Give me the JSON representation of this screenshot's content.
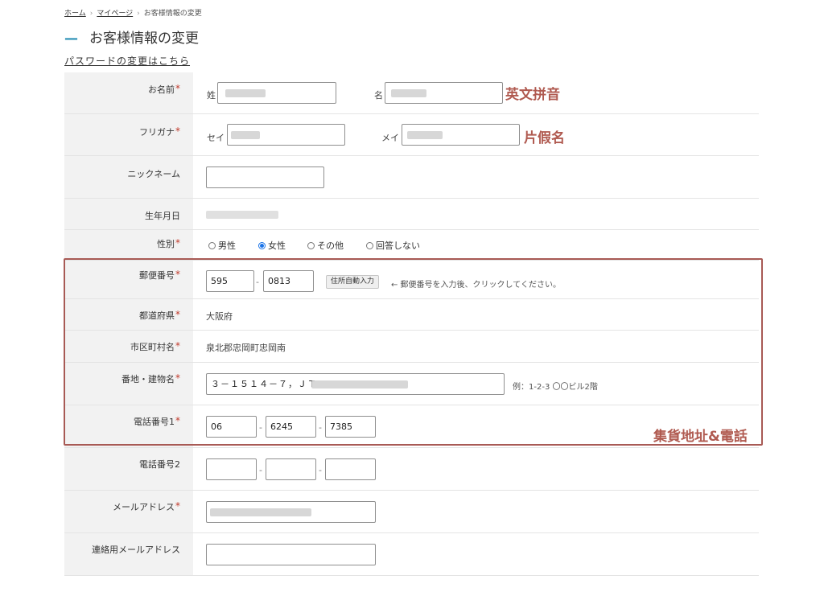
{
  "breadcrumb": {
    "home": "ホーム",
    "mypage": "マイページ",
    "current": "お客様情報の変更",
    "sep": "›"
  },
  "page": {
    "title": "お客様情報の変更",
    "title_dash": "—",
    "password_link": "パスワードの変更はこちら"
  },
  "fields": {
    "name": {
      "label": "お名前",
      "req": "*",
      "sei_label": "姓",
      "mei_label": "名"
    },
    "furigana": {
      "label": "フリガナ",
      "req": "*",
      "sei_label": "セイ",
      "mei_label": "メイ"
    },
    "nickname": {
      "label": "ニックネーム"
    },
    "birthday": {
      "label": "生年月日"
    },
    "gender": {
      "label": "性別",
      "req": "*",
      "options": [
        "男性",
        "女性",
        "その他",
        "回答しない"
      ],
      "selected": "女性"
    },
    "postal": {
      "label": "郵便番号",
      "req": "*",
      "part1": "595",
      "part2": "0813",
      "dash": "-",
      "auto_button": "住所自動入力",
      "hint": "← 郵便番号を入力後、クリックしてください。"
    },
    "prefecture": {
      "label": "都道府県",
      "req": "*",
      "value": "大阪府"
    },
    "city": {
      "label": "市区町村名",
      "req": "*",
      "value": "泉北郡忠岡町忠岡南"
    },
    "address": {
      "label": "番地・建物名",
      "req": "*",
      "value": "３－１５１４－７，ＪＴ",
      "example": "例：1-2-3 〇〇ビル2階"
    },
    "phone1": {
      "label": "電話番号1",
      "req": "*",
      "part1": "06",
      "part2": "6245",
      "part3": "7385",
      "dash": "-"
    },
    "phone2": {
      "label": "電話番号2",
      "dash": "-"
    },
    "email": {
      "label": "メールアドレス",
      "req": "*"
    },
    "contact_email": {
      "label": "連絡用メールアドレス"
    }
  },
  "annotations": {
    "name": "英文拼音",
    "furigana": "片假名",
    "shipping": "集貨地址&電話"
  },
  "colors": {
    "accent": "#2a8fb5",
    "required": "#c0392b",
    "annotation": "#b05a50",
    "radio_selected": "#1a73e8"
  }
}
